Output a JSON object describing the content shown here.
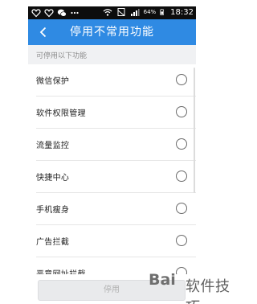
{
  "status_bar": {
    "battery_percent": "64%",
    "time": "18:32",
    "icons": [
      "heart-outline-icon",
      "heart-outline-icon",
      "wechat-icon",
      "ellipsis-icon",
      "wifi-icon",
      "sim-icon",
      "signal-icon",
      "battery-icon"
    ]
  },
  "header": {
    "back_icon": "chevron-left-icon",
    "title": "停用不常用功能"
  },
  "section": {
    "caption": "可停用以下功能"
  },
  "items": [
    {
      "label": "微信保护",
      "selected": false
    },
    {
      "label": "软件权限管理",
      "selected": false
    },
    {
      "label": "流量监控",
      "selected": false
    },
    {
      "label": "快捷中心",
      "selected": false
    },
    {
      "label": "手机瘦身",
      "selected": false
    },
    {
      "label": "广告拦截",
      "selected": false
    },
    {
      "label": "恶意网址拦截",
      "selected": false
    }
  ],
  "footer": {
    "button_label": "停用",
    "button_enabled": false
  },
  "watermark": {
    "logo": "Bai",
    "text": "软件技巧"
  },
  "colors": {
    "app_bar": "#2f8ae3",
    "status_bar": "#0d0d0d",
    "section_bg": "#f0f1f3",
    "button_bg": "#e9eaec"
  }
}
